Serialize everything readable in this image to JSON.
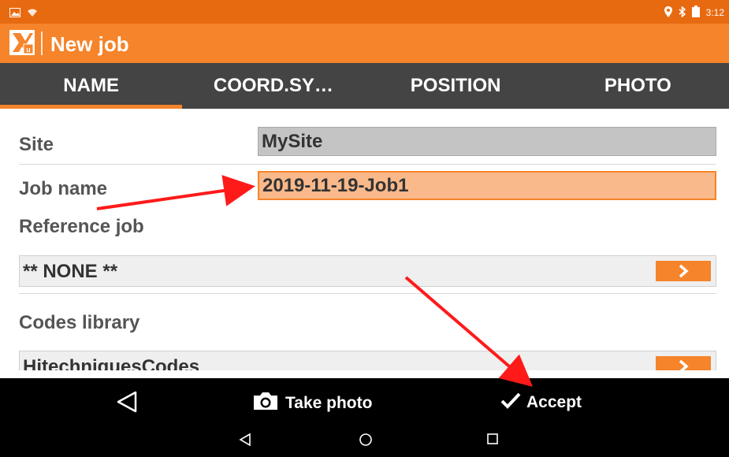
{
  "status_bar": {
    "time": "3:12",
    "icons_left": [
      "image-icon",
      "wifi-icon"
    ],
    "icons_right": [
      "location-icon",
      "bluetooth-icon",
      "battery-icon"
    ]
  },
  "app_bar": {
    "title": "New job",
    "logo": "app-logo-icon"
  },
  "tabs": [
    {
      "label": "NAME",
      "active": true
    },
    {
      "label": "COORD.SY…",
      "active": false
    },
    {
      "label": "POSITION",
      "active": false
    },
    {
      "label": "PHOTO",
      "active": false
    }
  ],
  "form": {
    "site_label": "Site",
    "site_value": "MySite",
    "job_name_label": "Job name",
    "job_name_value": "2019-11-19-Job1",
    "reference_job_label": "Reference job",
    "reference_job_value": "** NONE **",
    "codes_library_label": "Codes library",
    "codes_library_value": "HitechniquesCodes"
  },
  "action_bar": {
    "take_photo_label": "Take photo",
    "accept_label": "Accept"
  },
  "colors": {
    "status_bar": "#e86a10",
    "app_bar": "#f5842a",
    "tab_bar": "#444444",
    "active_field": "#f9b98a",
    "annotation_arrow": "#ff1a1a"
  }
}
